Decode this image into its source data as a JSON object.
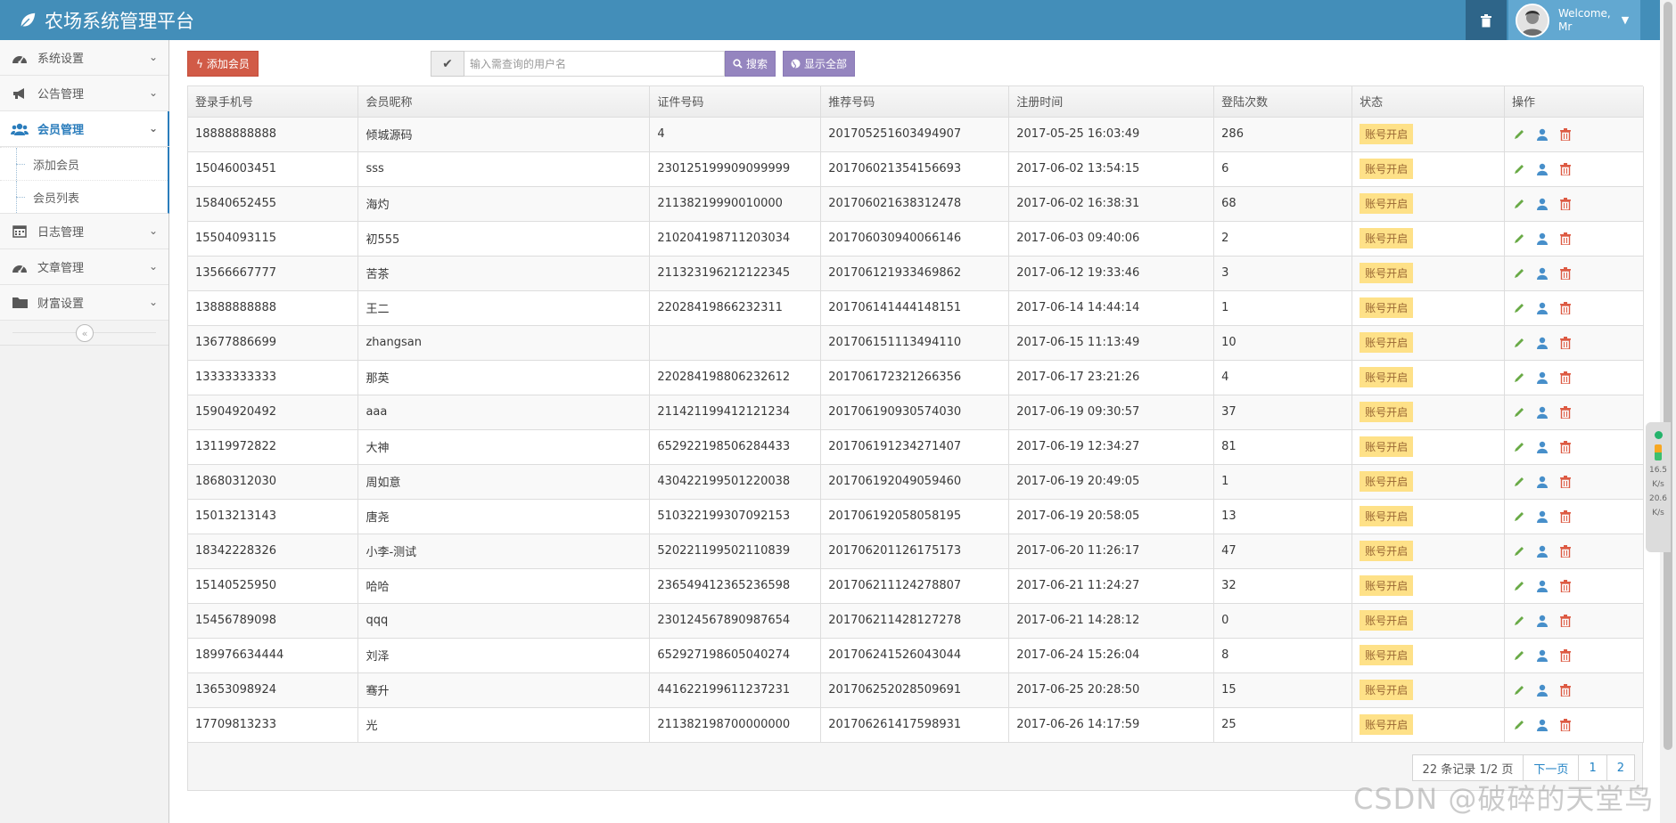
{
  "app": {
    "title": "农场系统管理平台"
  },
  "header": {
    "welcome": "Welcome,",
    "user": "Mr"
  },
  "sidebar": {
    "items": [
      {
        "label": "系统设置",
        "icon": "dashboard-icon"
      },
      {
        "label": "公告管理",
        "icon": "bullhorn-icon"
      },
      {
        "label": "会员管理",
        "icon": "users-icon",
        "active": true
      },
      {
        "label": "日志管理",
        "icon": "calendar-icon"
      },
      {
        "label": "文章管理",
        "icon": "dashboard-icon"
      },
      {
        "label": "财富设置",
        "icon": "folder-icon"
      }
    ],
    "submenu": [
      {
        "label": "添加会员"
      },
      {
        "label": "会员列表"
      }
    ]
  },
  "toolbar": {
    "add_label": "添加会员",
    "search_placeholder": "输入需查询的用户名",
    "search_label": "搜索",
    "showall_label": "显示全部"
  },
  "table": {
    "columns": [
      "登录手机号",
      "会员昵称",
      "证件号码",
      "推荐号码",
      "注册时间",
      "登陆次数",
      "状态",
      "操作"
    ],
    "rows": [
      [
        "18888888888",
        "倾城源码",
        "4",
        "201705251603494907",
        "2017-05-25 16:03:49",
        "286",
        "账号开启"
      ],
      [
        "15046003451",
        "sss",
        "230125199909099999",
        "201706021354156693",
        "2017-06-02 13:54:15",
        "6",
        "账号开启"
      ],
      [
        "15840652455",
        "海灼",
        "21138219990010000",
        "201706021638312478",
        "2017-06-02 16:38:31",
        "68",
        "账号开启"
      ],
      [
        "15504093115",
        "初555",
        "210204198711203034",
        "201706030940066146",
        "2017-06-03 09:40:06",
        "2",
        "账号开启"
      ],
      [
        "13566667777",
        "苦茶",
        "211323196212122345",
        "201706121933469862",
        "2017-06-12 19:33:46",
        "3",
        "账号开启"
      ],
      [
        "13888888888",
        "王二",
        "22028419866232311",
        "201706141444148151",
        "2017-06-14 14:44:14",
        "1",
        "账号开启"
      ],
      [
        "13677886699",
        "zhangsan",
        "",
        "201706151113494110",
        "2017-06-15 11:13:49",
        "10",
        "账号开启"
      ],
      [
        "13333333333",
        "那英",
        "220284198806232612",
        "201706172321266356",
        "2017-06-17 23:21:26",
        "4",
        "账号开启"
      ],
      [
        "15904920492",
        "aaa",
        "211421199412121234",
        "201706190930574030",
        "2017-06-19 09:30:57",
        "37",
        "账号开启"
      ],
      [
        "13119972822",
        "大神",
        "652922198506284433",
        "201706191234271407",
        "2017-06-19 12:34:27",
        "81",
        "账号开启"
      ],
      [
        "18680312030",
        "周如意",
        "430422199501220038",
        "201706192049059460",
        "2017-06-19 20:49:05",
        "1",
        "账号开启"
      ],
      [
        "15013213143",
        "唐尧",
        "510322199307092153",
        "201706192058058195",
        "2017-06-19 20:58:05",
        "13",
        "账号开启"
      ],
      [
        "18342228326",
        "小李-测试",
        "520221199502110839",
        "201706201126175173",
        "2017-06-20 11:26:17",
        "47",
        "账号开启"
      ],
      [
        "15140525950",
        "哈哈",
        "236549412365236598",
        "201706211124278807",
        "2017-06-21 11:24:27",
        "32",
        "账号开启"
      ],
      [
        "15456789098",
        "qqq",
        "230124567890987654",
        "201706211428127278",
        "2017-06-21 14:28:12",
        "0",
        "账号开启"
      ],
      [
        "189976634444",
        "刘泽",
        "652927198605040274",
        "201706241526043044",
        "2017-06-24 15:26:04",
        "8",
        "账号开启"
      ],
      [
        "13653098924",
        "骞升",
        "441622199611237231",
        "201706252028509691",
        "2017-06-25 20:28:50",
        "15",
        "账号开启"
      ],
      [
        "17709813233",
        "光",
        "211382198700000000",
        "201706261417598931",
        "2017-06-26 14:17:59",
        "25",
        "账号开启"
      ]
    ]
  },
  "pager": {
    "info": "22 条记录 1/2 页",
    "next": "下一页",
    "pages": [
      "1",
      "2"
    ]
  },
  "widget": {
    "up": "16.5",
    "down": "20.6",
    "unit": "K/s"
  },
  "watermark": "CSDN @破碎的天堂鸟",
  "colors": {
    "navbar": "#438eb9",
    "add_button": "#d15b47",
    "purple_button": "#9585bf",
    "badge": "#fee188",
    "edit": "#69aa46",
    "user": "#478fca",
    "delete": "#dd5a43"
  }
}
